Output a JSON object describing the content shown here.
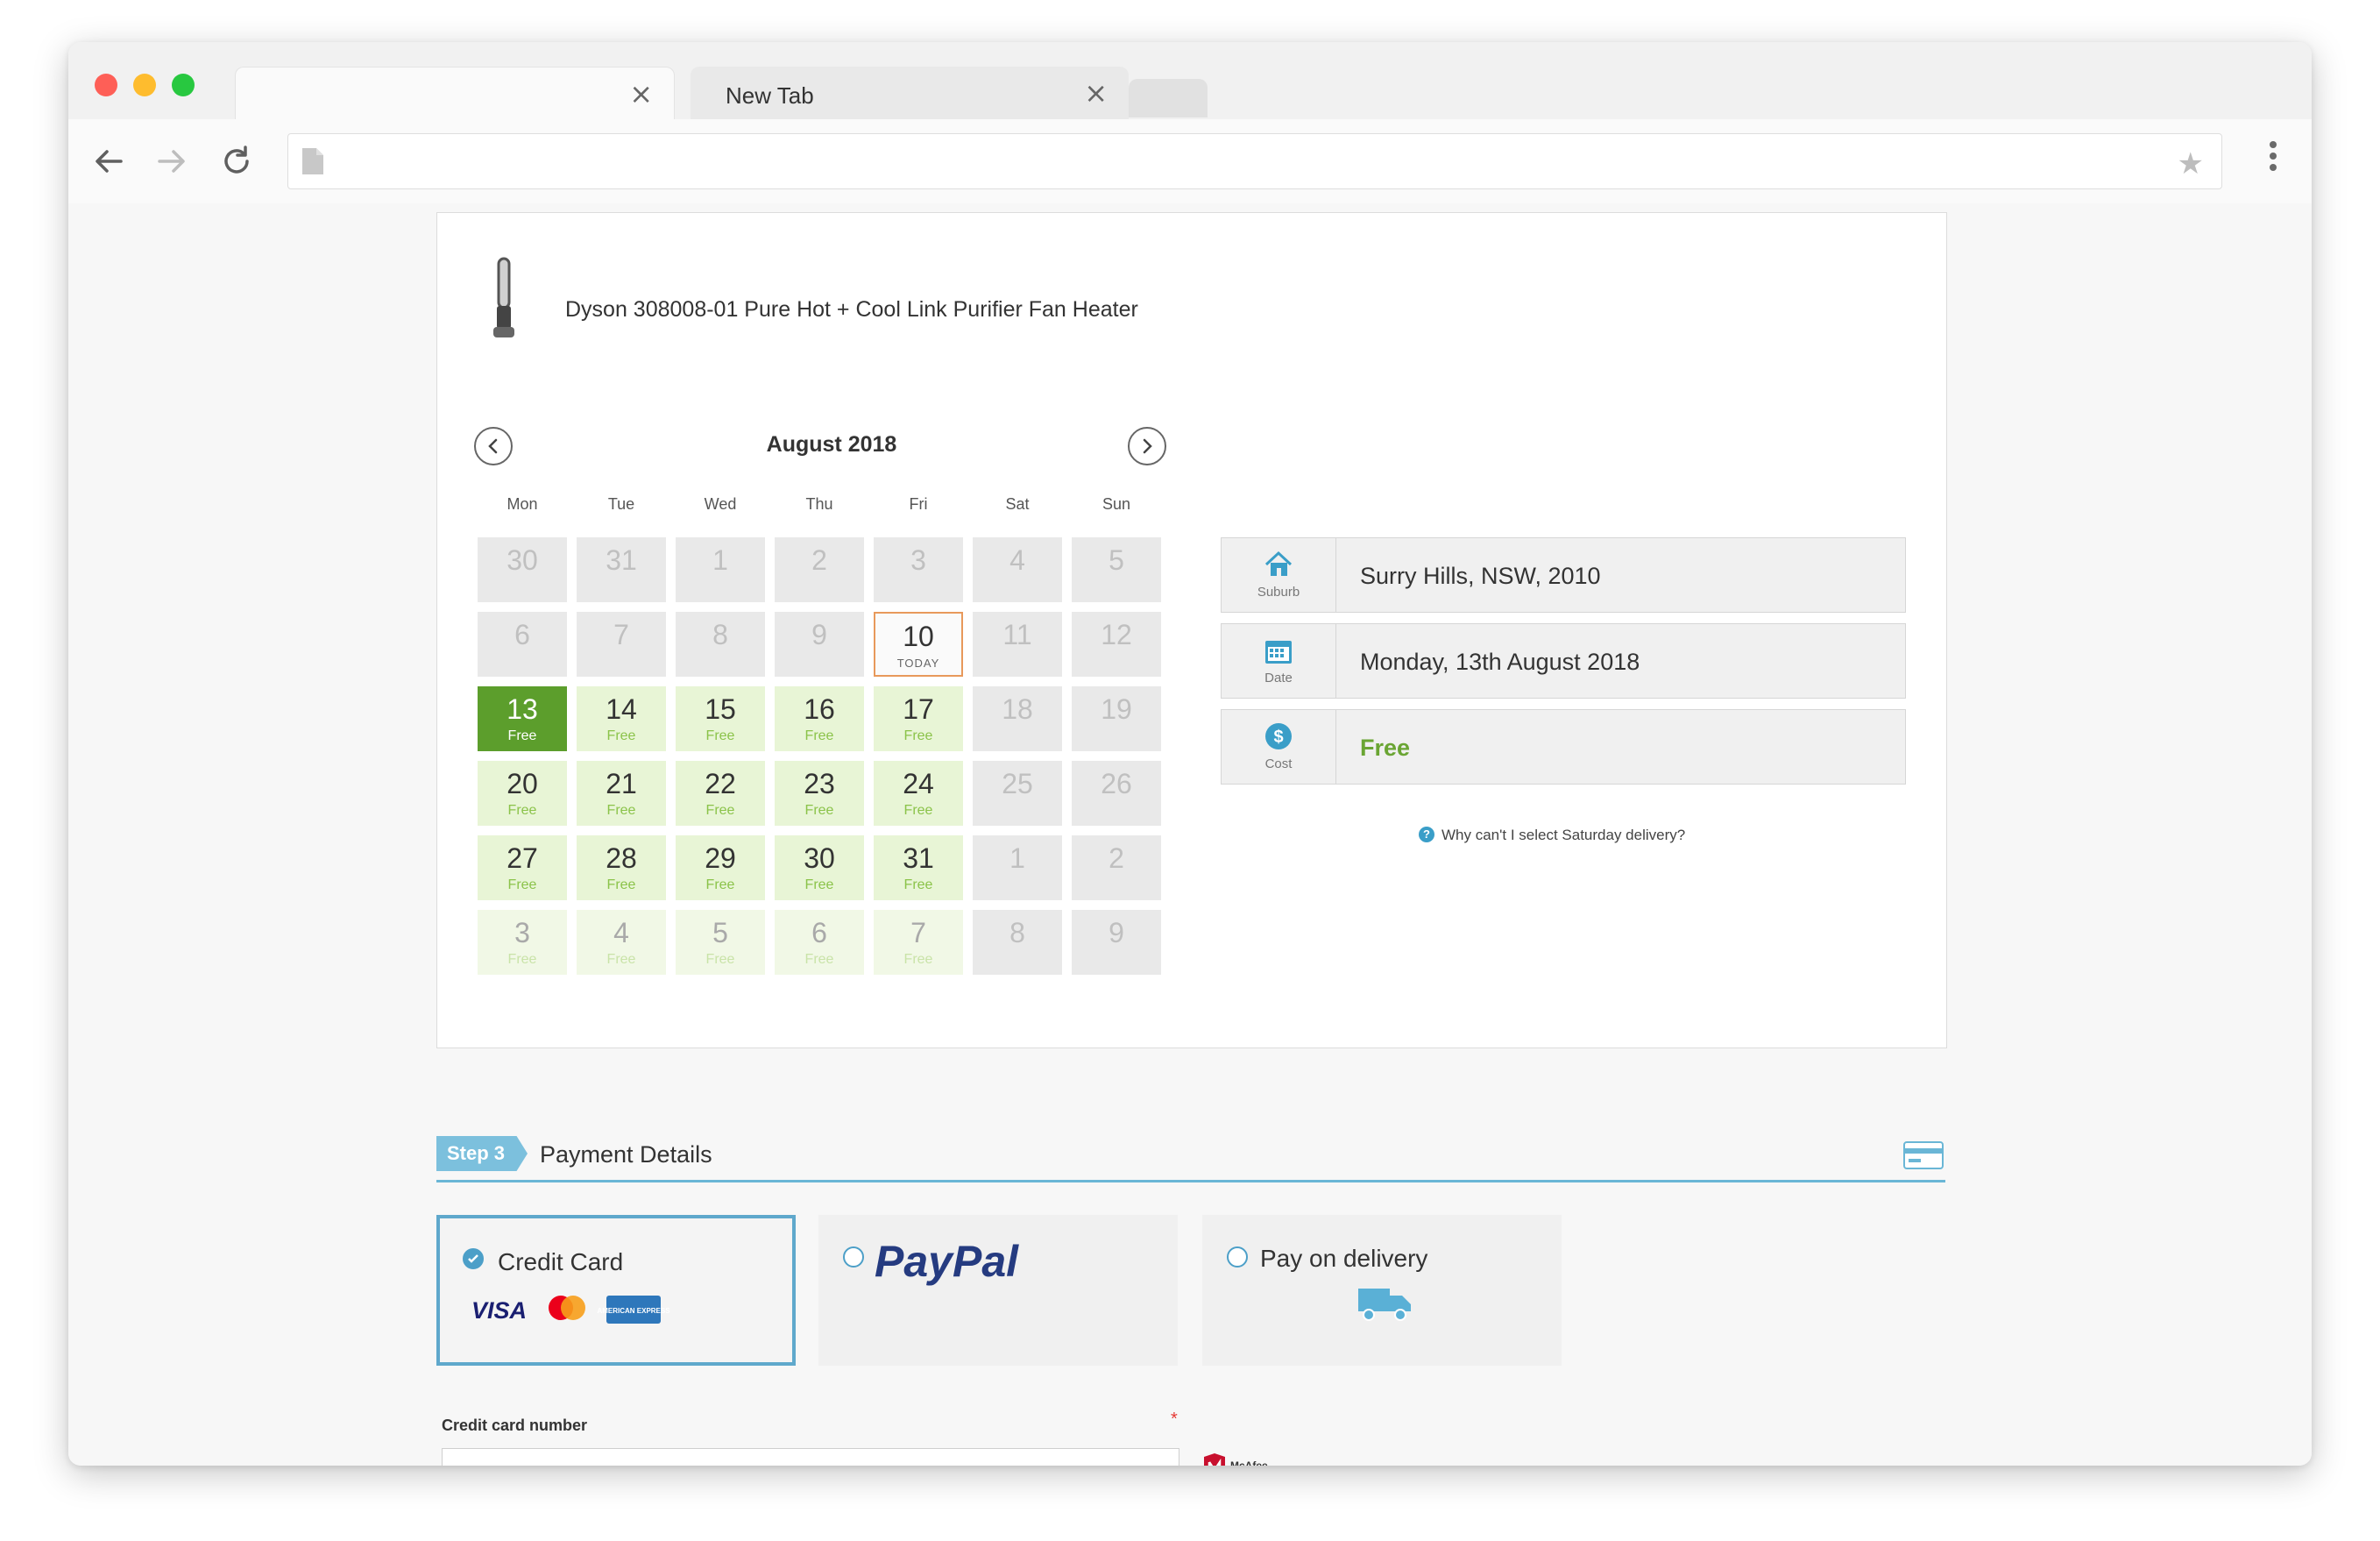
{
  "browser": {
    "active_tab_title": "",
    "inactive_tab_title": "New Tab",
    "address": ""
  },
  "product": {
    "name": "Dyson 308008-01 Pure Hot + Cool Link Purifier Fan Heater"
  },
  "calendar": {
    "month_title": "August 2018",
    "weekdays": [
      "Mon",
      "Tue",
      "Wed",
      "Thu",
      "Fri",
      "Sat",
      "Sun"
    ],
    "free_label": "Free",
    "today_label": "TODAY",
    "rows": [
      [
        {
          "d": "30",
          "s": "off"
        },
        {
          "d": "31",
          "s": "off"
        },
        {
          "d": "1",
          "s": "off"
        },
        {
          "d": "2",
          "s": "off"
        },
        {
          "d": "3",
          "s": "off"
        },
        {
          "d": "4",
          "s": "off"
        },
        {
          "d": "5",
          "s": "off"
        }
      ],
      [
        {
          "d": "6",
          "s": "off"
        },
        {
          "d": "7",
          "s": "off"
        },
        {
          "d": "8",
          "s": "off"
        },
        {
          "d": "9",
          "s": "off"
        },
        {
          "d": "10",
          "s": "today"
        },
        {
          "d": "11",
          "s": "off"
        },
        {
          "d": "12",
          "s": "off"
        }
      ],
      [
        {
          "d": "13",
          "s": "selected"
        },
        {
          "d": "14",
          "s": "free"
        },
        {
          "d": "15",
          "s": "free"
        },
        {
          "d": "16",
          "s": "free"
        },
        {
          "d": "17",
          "s": "free"
        },
        {
          "d": "18",
          "s": "off"
        },
        {
          "d": "19",
          "s": "off"
        }
      ],
      [
        {
          "d": "20",
          "s": "free"
        },
        {
          "d": "21",
          "s": "free"
        },
        {
          "d": "22",
          "s": "free"
        },
        {
          "d": "23",
          "s": "free"
        },
        {
          "d": "24",
          "s": "free"
        },
        {
          "d": "25",
          "s": "off"
        },
        {
          "d": "26",
          "s": "off"
        }
      ],
      [
        {
          "d": "27",
          "s": "free"
        },
        {
          "d": "28",
          "s": "free"
        },
        {
          "d": "29",
          "s": "free"
        },
        {
          "d": "30",
          "s": "free"
        },
        {
          "d": "31",
          "s": "free"
        },
        {
          "d": "1",
          "s": "off"
        },
        {
          "d": "2",
          "s": "off"
        }
      ],
      [
        {
          "d": "3",
          "s": "free-next"
        },
        {
          "d": "4",
          "s": "free-next"
        },
        {
          "d": "5",
          "s": "free-next"
        },
        {
          "d": "6",
          "s": "free-next"
        },
        {
          "d": "7",
          "s": "free-next"
        },
        {
          "d": "8",
          "s": "off"
        },
        {
          "d": "9",
          "s": "off"
        }
      ]
    ]
  },
  "delivery": {
    "suburb_label": "Suburb",
    "suburb_value": "Surry Hills, NSW, 2010",
    "date_label": "Date",
    "date_value": "Monday, 13th August 2018",
    "cost_label": "Cost",
    "cost_value": "Free",
    "saturday_note": "Why can't I select Saturday delivery?",
    "colors": {
      "free_green": "#6aa533",
      "selected_green": "#5c9e2c",
      "today_border": "#e8995b"
    }
  },
  "payment": {
    "step_badge": "Step 3",
    "step_title": "Payment Details",
    "options": [
      {
        "label": "Credit Card",
        "selected": true
      },
      {
        "label": "PayPal",
        "selected": false
      },
      {
        "label": "Pay on delivery",
        "selected": false
      }
    ],
    "card_brands": [
      "VISA",
      "mastercard",
      "AMERICAN EXPRESS"
    ],
    "cc_number_label": "Credit card number",
    "required_mark": "*",
    "cc_number_value": "",
    "trust_badge": "McAfee SECURE"
  }
}
